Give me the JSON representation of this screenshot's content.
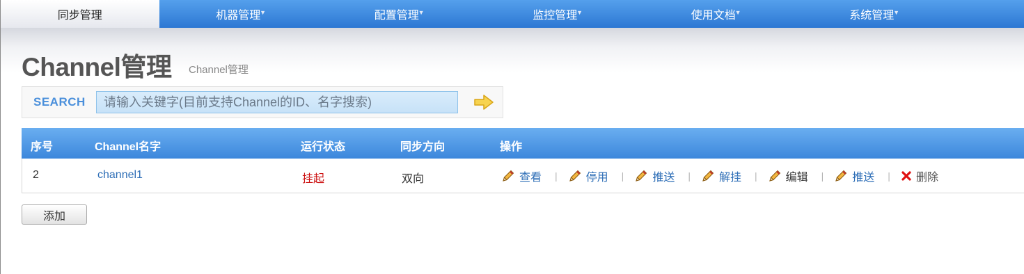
{
  "nav": {
    "items": [
      {
        "label": "同步管理",
        "active": true
      },
      {
        "label": "机器管理",
        "has_dropdown": true
      },
      {
        "label": "配置管理",
        "has_dropdown": true
      },
      {
        "label": "监控管理",
        "has_dropdown": true
      },
      {
        "label": "使用文档",
        "has_dropdown": true
      },
      {
        "label": "系统管理",
        "has_dropdown": true
      }
    ],
    "caret": "▼"
  },
  "page": {
    "title": "Channel管理",
    "subtitle": "Channel管理"
  },
  "search": {
    "label": "SEARCH",
    "placeholder": "请输入关键字(目前支持Channel的ID、名字搜索)",
    "go_icon": "arrow-right-icon"
  },
  "table": {
    "headers": [
      "序号",
      "Channel名字",
      "运行状态",
      "同步方向",
      "操作"
    ],
    "rows": [
      {
        "id": "2",
        "name": "channel1",
        "status": "挂起",
        "direction": "双向",
        "actions": [
          "查看",
          "停用",
          "推送",
          "解挂",
          "编辑",
          "推送",
          "删除"
        ]
      }
    ]
  },
  "buttons": {
    "add": "添加"
  },
  "colors": {
    "nav_blue": "#2d78d3",
    "header_blue": "#3c87dc",
    "link": "#2f6fb7",
    "status_red": "#cc1010",
    "delete_red": "#e01010"
  }
}
